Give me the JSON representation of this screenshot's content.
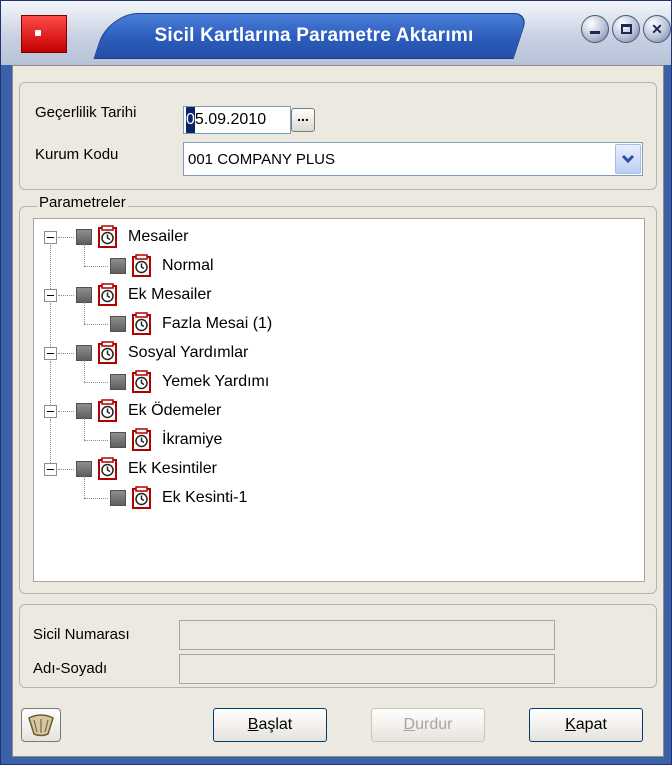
{
  "window": {
    "title": "Sicil Kartlarına Parametre Aktarımı",
    "accent": "#2c5cbc"
  },
  "header": {
    "date_label": "Geçerlilik Tarihi",
    "date_value_selected": "0",
    "date_value_rest": "5.09.2010",
    "ellipsis": "...",
    "org_label": "Kurum Kodu",
    "org_value": "001 COMPANY PLUS"
  },
  "params": {
    "group_label": "Parametreler",
    "groups": [
      {
        "label": "Mesailer",
        "children": [
          "Normal"
        ]
      },
      {
        "label": "Ek Mesailer",
        "children": [
          "Fazla Mesai (1)"
        ]
      },
      {
        "label": "Sosyal Yardımlar",
        "children": [
          "Yemek Yardımı"
        ]
      },
      {
        "label": "Ek Ödemeler",
        "children": [
          "İkramiye"
        ]
      },
      {
        "label": "Ek Kesintiler",
        "children": [
          "Ek Kesinti-1"
        ]
      }
    ],
    "icon": "clock-icon"
  },
  "progress": {
    "sicil_label": "Sicil Numarası",
    "sicil_value": "",
    "name_label": "Adı-Soyadı",
    "name_value": ""
  },
  "buttons": {
    "start_pre": "",
    "start_u": "B",
    "start_post": "aşlat",
    "stop_pre": "",
    "stop_u": "D",
    "stop_post": "urdur",
    "close_pre": "",
    "close_u": "K",
    "close_post": "apat"
  }
}
